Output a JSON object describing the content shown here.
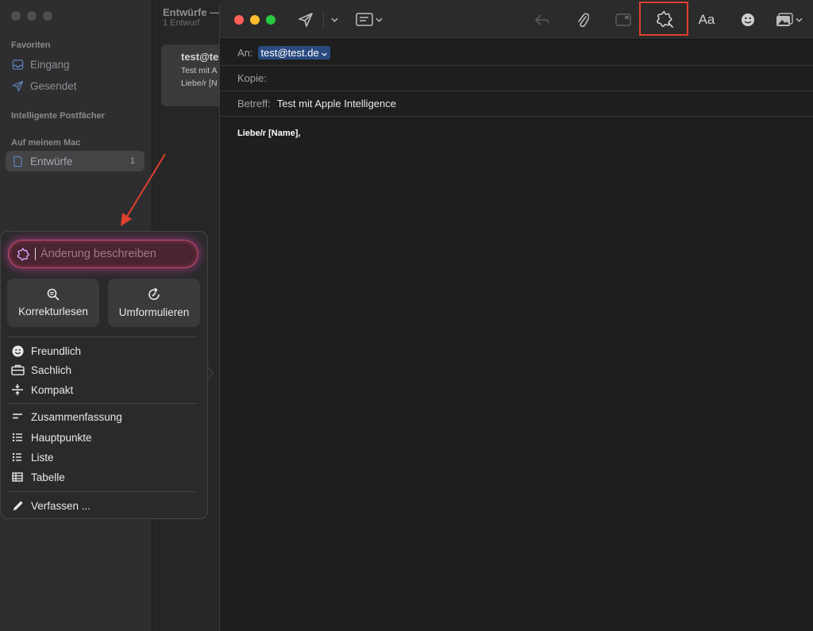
{
  "sidebar": {
    "favorites_label": "Favoriten",
    "inbox_label": "Eingang",
    "sent_label": "Gesendet",
    "smart_label": "Intelligente Postfächer",
    "mac_label": "Auf meinem Mac",
    "drafts_label": "Entwürfe",
    "drafts_count": "1"
  },
  "message_list": {
    "title": "Entwürfe —",
    "subtitle": "1 Entwurf",
    "card_from": "test@te",
    "card_subject": "Test mit A",
    "card_preview": "Liebe/r [N"
  },
  "compose": {
    "to_label": "An:",
    "to_value": "test@test.de",
    "cc_label": "Kopie:",
    "subject_label": "Betreff:",
    "subject_value": "Test mit Apple Intelligence",
    "body": "Liebe/r [Name],",
    "format_label": "Aa"
  },
  "writing_tools": {
    "input_placeholder": "Änderung beschreiben",
    "proofread_label": "Korrekturlesen",
    "rewrite_label": "Umformulieren",
    "friendly_label": "Freundlich",
    "professional_label": "Sachlich",
    "concise_label": "Kompakt",
    "summary_label": "Zusammenfassung",
    "keypoints_label": "Hauptpunkte",
    "list_label": "Liste",
    "table_label": "Tabelle",
    "compose_label": "Verfassen ..."
  },
  "colors": {
    "highlight": "#e0402e",
    "close": "#ff5f57",
    "minimize": "#febc2e",
    "zoom": "#28c840",
    "recipient_bg": "#2a4a7f"
  },
  "icons": [
    "inbox-icon",
    "sent-icon",
    "draft-icon",
    "send-icon",
    "chevron-down-icon",
    "header-fields-icon",
    "reply-icon",
    "attachment-icon",
    "markup-icon",
    "writing-tools-icon",
    "emoji-icon",
    "photo-icon",
    "proofread-icon",
    "rewrite-icon",
    "smiley-icon",
    "briefcase-icon",
    "compact-icon",
    "summary-icon",
    "keypoints-icon",
    "list-icon",
    "table-icon",
    "pencil-icon"
  ]
}
